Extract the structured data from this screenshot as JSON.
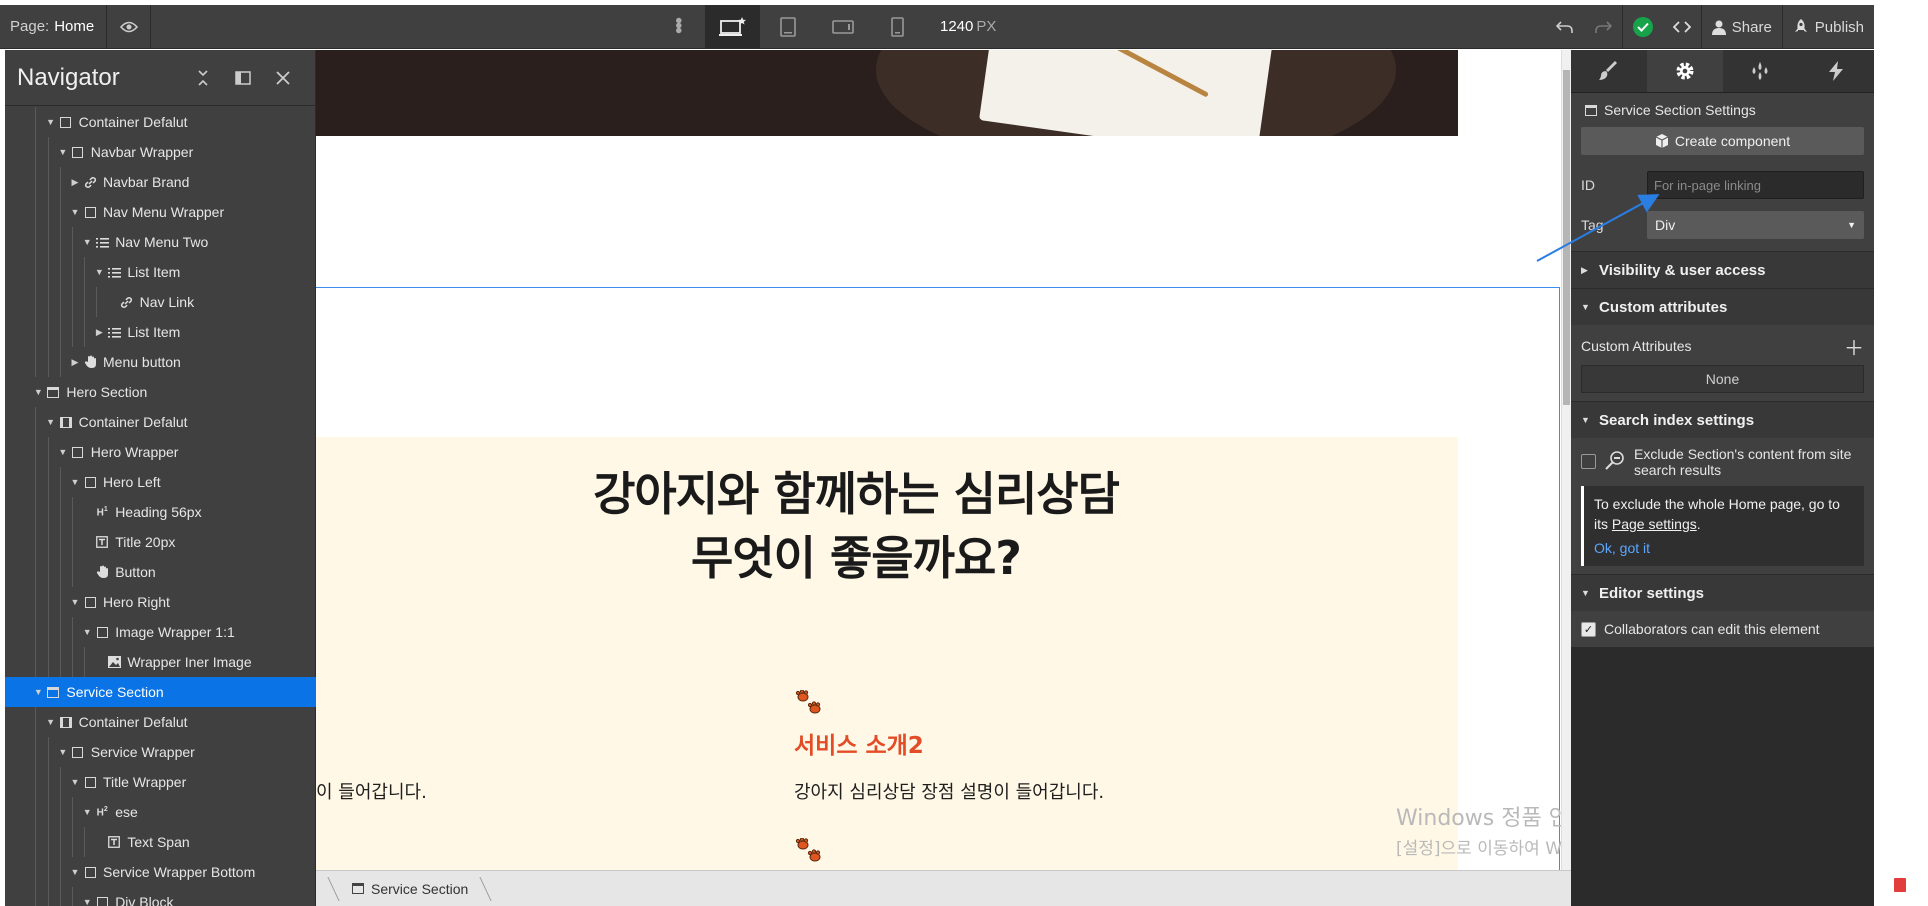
{
  "topbar": {
    "page_label": "Page:",
    "page_name": "Home",
    "width_value": "1240",
    "width_unit": "PX",
    "share_label": "Share",
    "publish_label": "Publish"
  },
  "navigator": {
    "title": "Navigator",
    "items": [
      {
        "label": "Container Defalut",
        "depth": 3,
        "caret": "down",
        "icon": "box"
      },
      {
        "label": "Navbar Wrapper",
        "depth": 4,
        "caret": "down",
        "icon": "box"
      },
      {
        "label": "Navbar Brand",
        "depth": 5,
        "caret": "right",
        "icon": "link"
      },
      {
        "label": "Nav Menu Wrapper",
        "depth": 5,
        "caret": "down",
        "icon": "box"
      },
      {
        "label": "Nav Menu Two",
        "depth": 6,
        "caret": "down",
        "icon": "list"
      },
      {
        "label": "List Item",
        "depth": 7,
        "caret": "down",
        "icon": "list"
      },
      {
        "label": "Nav Link",
        "depth": 8,
        "caret": "",
        "icon": "link"
      },
      {
        "label": "List Item",
        "depth": 7,
        "caret": "right",
        "icon": "list"
      },
      {
        "label": "Menu button",
        "depth": 5,
        "caret": "right",
        "icon": "hand"
      },
      {
        "label": "Hero Section",
        "depth": 2,
        "caret": "down",
        "icon": "section"
      },
      {
        "label": "Container Defalut",
        "depth": 3,
        "caret": "down",
        "icon": "container"
      },
      {
        "label": "Hero Wrapper",
        "depth": 4,
        "caret": "down",
        "icon": "box"
      },
      {
        "label": "Hero Left",
        "depth": 5,
        "caret": "down",
        "icon": "box"
      },
      {
        "label": "Heading 56px",
        "depth": 6,
        "caret": "",
        "icon": "h1"
      },
      {
        "label": "Title 20px",
        "depth": 6,
        "caret": "",
        "icon": "text"
      },
      {
        "label": "Button",
        "depth": 6,
        "caret": "",
        "icon": "hand"
      },
      {
        "label": "Hero Right",
        "depth": 5,
        "caret": "down",
        "icon": "box"
      },
      {
        "label": "Image Wrapper 1:1",
        "depth": 6,
        "caret": "down",
        "icon": "box"
      },
      {
        "label": "Wrapper Iner Image",
        "depth": 7,
        "caret": "",
        "icon": "image"
      },
      {
        "label": "Service Section",
        "depth": 2,
        "caret": "down",
        "icon": "section",
        "selected": true
      },
      {
        "label": "Container Defalut",
        "depth": 3,
        "caret": "down",
        "icon": "container"
      },
      {
        "label": "Service Wrapper",
        "depth": 4,
        "caret": "down",
        "icon": "box"
      },
      {
        "label": "Title Wrapper",
        "depth": 5,
        "caret": "down",
        "icon": "box"
      },
      {
        "label": "ese",
        "depth": 6,
        "caret": "down",
        "icon": "h2"
      },
      {
        "label": "Text Span",
        "depth": 7,
        "caret": "",
        "icon": "text"
      },
      {
        "label": "Service Wrapper Bottom",
        "depth": 5,
        "caret": "down",
        "icon": "box"
      },
      {
        "label": "Div Block",
        "depth": 6,
        "caret": "down",
        "icon": "box"
      }
    ]
  },
  "canvas": {
    "title_line1": "강아지와 함께하는 심리상담",
    "title_line2": "무엇이 좋을까요?",
    "service_heading_2": "서비스 소개2",
    "desc_left": "이 들어갑니다.",
    "desc_right": "강아지 심리상담 장점 설명이 들어갑니다.",
    "watermark_title": "Windows 정품 인증",
    "watermark_text": "[설정]으로 이동하여 Windows를 정품 인증합니다."
  },
  "breadcrumb": {
    "current": "Service Section"
  },
  "panel": {
    "section_settings_title": "Service Section Settings",
    "create_component_label": "Create component",
    "id_label": "ID",
    "id_placeholder": "For in-page linking",
    "tag_label": "Tag",
    "tag_value": "Div",
    "visibility_label": "Visibility & user access",
    "custom_attributes_label": "Custom attributes",
    "custom_attributes_sub": "Custom Attributes",
    "custom_attributes_value": "None",
    "search_index_label": "Search index settings",
    "exclude_text": "Exclude Section's content from site search results",
    "info_text_before": "To exclude the whole Home page, go to its ",
    "info_link": "Page settings",
    "info_text_after": ".",
    "ok_label": "Ok, got it",
    "editor_settings_label": "Editor settings",
    "collaborators_label": "Collaborators can edit this element"
  },
  "colors": {
    "selected": "#0a73e6",
    "accent_heading": "#e24d28",
    "section_bg": "#fff8e6",
    "ui_dark": "#404040"
  }
}
